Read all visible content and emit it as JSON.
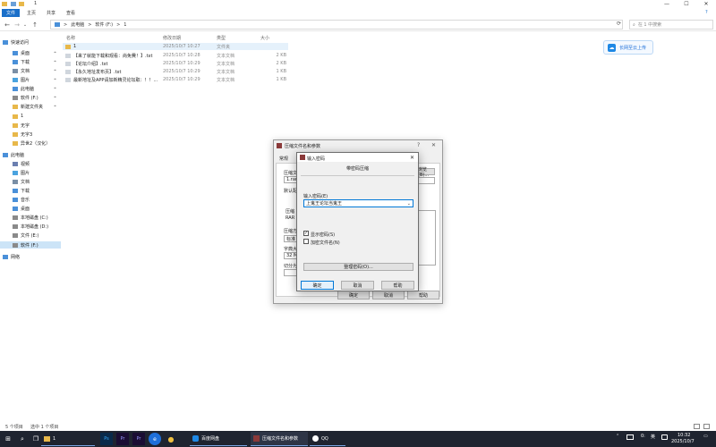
{
  "window": {
    "title": "1",
    "controls": {
      "minimize": "—",
      "maximize": "☐",
      "close": "✕"
    }
  },
  "ribbon": {
    "tabs": [
      {
        "label": "文件",
        "active": true
      },
      {
        "label": "主页",
        "active": false
      },
      {
        "label": "共享",
        "active": false
      },
      {
        "label": "查看",
        "active": false
      }
    ],
    "help": "?"
  },
  "address": {
    "back_icon": "←",
    "forward_icon": "→",
    "recent_icon": "⌄",
    "up_icon": "↑",
    "crumbs": [
      "此电脑",
      "软件 (F:)",
      "1"
    ],
    "sep": ">",
    "refresh_icon": "⟳",
    "search_placeholder": "在 1 中搜索"
  },
  "nav": {
    "items": [
      {
        "label": "快速访问",
        "icon": "star-icon"
      },
      {
        "label": "桌面",
        "icon": "desktop-icon",
        "pinned": true
      },
      {
        "label": "下载",
        "icon": "download-icon",
        "pinned": true
      },
      {
        "label": "文档",
        "icon": "document-icon",
        "pinned": true
      },
      {
        "label": "图片",
        "icon": "picture-icon",
        "pinned": true
      },
      {
        "label": "此电脑",
        "icon": "pc-icon",
        "pinned": true
      },
      {
        "label": "软件 (F:)",
        "icon": "drive-icon",
        "pinned": true
      },
      {
        "label": "新建文件夹",
        "icon": "folder-icon",
        "pinned": true
      },
      {
        "label": "1",
        "icon": "folder-icon"
      },
      {
        "label": "无字",
        "icon": "folder-icon"
      },
      {
        "label": "无字3",
        "icon": "folder-icon"
      },
      {
        "label": "异世2（汉化）",
        "icon": "folder-icon"
      },
      {
        "label": "此电脑",
        "icon": "pc-icon"
      },
      {
        "label": "视频",
        "icon": "video-icon"
      },
      {
        "label": "图片",
        "icon": "picture-icon"
      },
      {
        "label": "文档",
        "icon": "document-icon"
      },
      {
        "label": "下载",
        "icon": "download-icon"
      },
      {
        "label": "音乐",
        "icon": "music-icon"
      },
      {
        "label": "桌面",
        "icon": "desktop-icon"
      },
      {
        "label": "本地磁盘 (C:)",
        "icon": "drive-icon"
      },
      {
        "label": "本地磁盘 (D:)",
        "icon": "drive-icon"
      },
      {
        "label": "文件 (E:)",
        "icon": "drive-icon"
      },
      {
        "label": "软件 (F:)",
        "icon": "drive-icon",
        "selected": true
      },
      {
        "label": "网络",
        "icon": "network-icon"
      }
    ],
    "pin_icon": "⌖"
  },
  "files": {
    "headers": {
      "name": "名称",
      "date": "修改日期",
      "type": "类型",
      "size": "大小"
    },
    "rows": [
      {
        "name": "1",
        "date": "2025/10/7 10:27",
        "type": "文件夹",
        "size": "",
        "kind": "folder",
        "selected": true
      },
      {
        "name": "【来了就能下载和观看：尚免費！】.txt",
        "date": "2025/10/7 10:28",
        "type": "文本文档",
        "size": "2 KB",
        "kind": "txt"
      },
      {
        "name": "【论坛介绍】.txt",
        "date": "2025/10/7 10:29",
        "type": "文本文档",
        "size": "2 KB",
        "kind": "txt"
      },
      {
        "name": "【永久地址发布页】.txt",
        "date": "2025/10/7 10:29",
        "type": "文本文档",
        "size": "1 KB",
        "kind": "txt"
      },
      {
        "name": "最新地址及APP请加新精灵论坛取：！！...",
        "date": "2025/10/7 10:29",
        "type": "文本文档",
        "size": "1 KB",
        "kind": "txt"
      }
    ]
  },
  "cloud": {
    "label": "长网至云上传"
  },
  "status": {
    "count": "5 个项目",
    "selected": "选中 1 个项目"
  },
  "dialog_params": {
    "title": "压缩文件名和参数",
    "help_icon": "?",
    "close_icon": "✕",
    "tab_general": "常规",
    "labels": [
      "压缩文",
      "1.rar",
      "默认配",
      "压缩",
      "压缩方",
      "标准",
      "字典大",
      "32 MB",
      "切分为"
    ],
    "radio_label": "RAR",
    "browse_label": "浏览(B)...",
    "ok": "确定",
    "cancel": "取消",
    "help": "帮助"
  },
  "dialog_pwd": {
    "title": "输入密码",
    "close_icon": "✕",
    "subtitle": "带密码压缩",
    "prompt": "输入密码(E)",
    "password_value": "上鬼王论坛当鬼王",
    "dropdown_icon": "⌄",
    "show_password": "显示密码(S)",
    "encrypt_names": "加密文件名(N)",
    "show_checked": true,
    "encrypt_checked": false,
    "organize": "整理密码(O)...",
    "ok": "确定",
    "cancel": "取消",
    "help": "帮助"
  },
  "taskbar": {
    "start_icon": "⊞",
    "search_icon": "⌕",
    "taskview_icon": "❐",
    "explorer_label": "1",
    "ps": "Ps",
    "pr": "Pr",
    "pr2": "Pr",
    "edge": "e",
    "chrome": "●",
    "baidu_label": "百度网盘",
    "winrar_label": "压缩文件名和参数",
    "qq_label": "QQ",
    "tray_up": "⌃",
    "tray_items": [
      "0:",
      "英"
    ],
    "time": "10:32",
    "date": "2025/10/7",
    "notify": "▭"
  }
}
